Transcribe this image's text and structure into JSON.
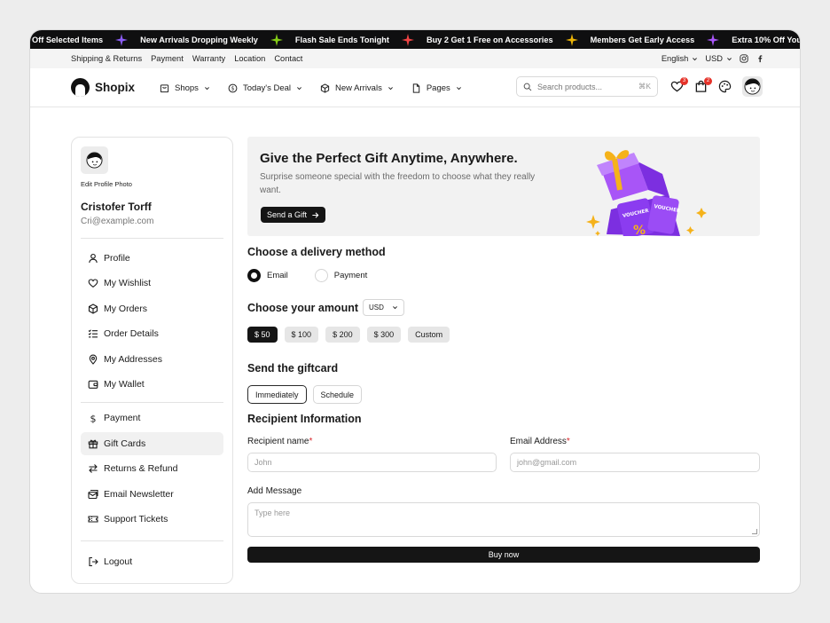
{
  "marquee": [
    "Off Selected Items",
    "New Arrivals Dropping Weekly",
    "Flash Sale Ends Tonight",
    "Buy 2 Get 1 Free on Accessories",
    "Members Get Early Access",
    "Extra 10% Off Your Fi"
  ],
  "marquee_star_colors": [
    "#8b5cf6",
    "#84cc16",
    "#ef4444",
    "#eab308",
    "#a855f7"
  ],
  "util": {
    "links": [
      "Shipping & Returns",
      "Payment",
      "Warranty",
      "Location",
      "Contact"
    ],
    "language": "English",
    "currency": "USD"
  },
  "header": {
    "brand": "Shopix",
    "nav": [
      "Shops",
      "Today's Deal",
      "New Arrivals",
      "Pages"
    ],
    "search_placeholder": "Search products...",
    "search_shortcut": "⌘K",
    "wishlist_count": "3",
    "cart_count": "2"
  },
  "sidebar": {
    "edit_photo": "Edit Profile Photo",
    "name": "Cristofer Torff",
    "email": "Cri@example.com",
    "items": [
      "Profile",
      "My Wishlist",
      "My Orders",
      "Order Details",
      "My Addresses",
      "My Wallet"
    ],
    "items2": [
      "Payment",
      "Gift Cards",
      "Returns & Refund",
      "Email Newsletter",
      "Support Tickets"
    ],
    "logout": "Logout"
  },
  "banner": {
    "title": "Give the Perfect Gift Anytime, Anywhere.",
    "subtitle": "Surprise someone special with the freedom to choose what they really want.",
    "button": "Send a Gift",
    "voucher_text": "VOUCHER"
  },
  "delivery": {
    "title": "Choose a delivery method",
    "options": [
      "Email",
      "Payment"
    ],
    "selected": "Email"
  },
  "amount": {
    "title": "Choose your amount",
    "currency": "USD",
    "options": [
      "$ 50",
      "$ 100",
      "$ 200",
      "$ 300",
      "Custom"
    ],
    "selected": "$ 50"
  },
  "send": {
    "title": "Send the giftcard",
    "options": [
      "Immediately",
      "Schedule"
    ],
    "selected": "Immediately"
  },
  "recipient": {
    "title": "Recipient Information",
    "name_label": "Recipient name",
    "name_placeholder": "John",
    "email_label": "Email Address",
    "email_placeholder": "john@gmail.com",
    "message_label": "Add Message",
    "message_placeholder": "Type here",
    "required_mark": "*"
  },
  "buy_button": "Buy now",
  "colors": {
    "dark": "#151515",
    "accent_red": "#e5332a",
    "purple": "#8b3cf0",
    "gold": "#f5b21a"
  }
}
